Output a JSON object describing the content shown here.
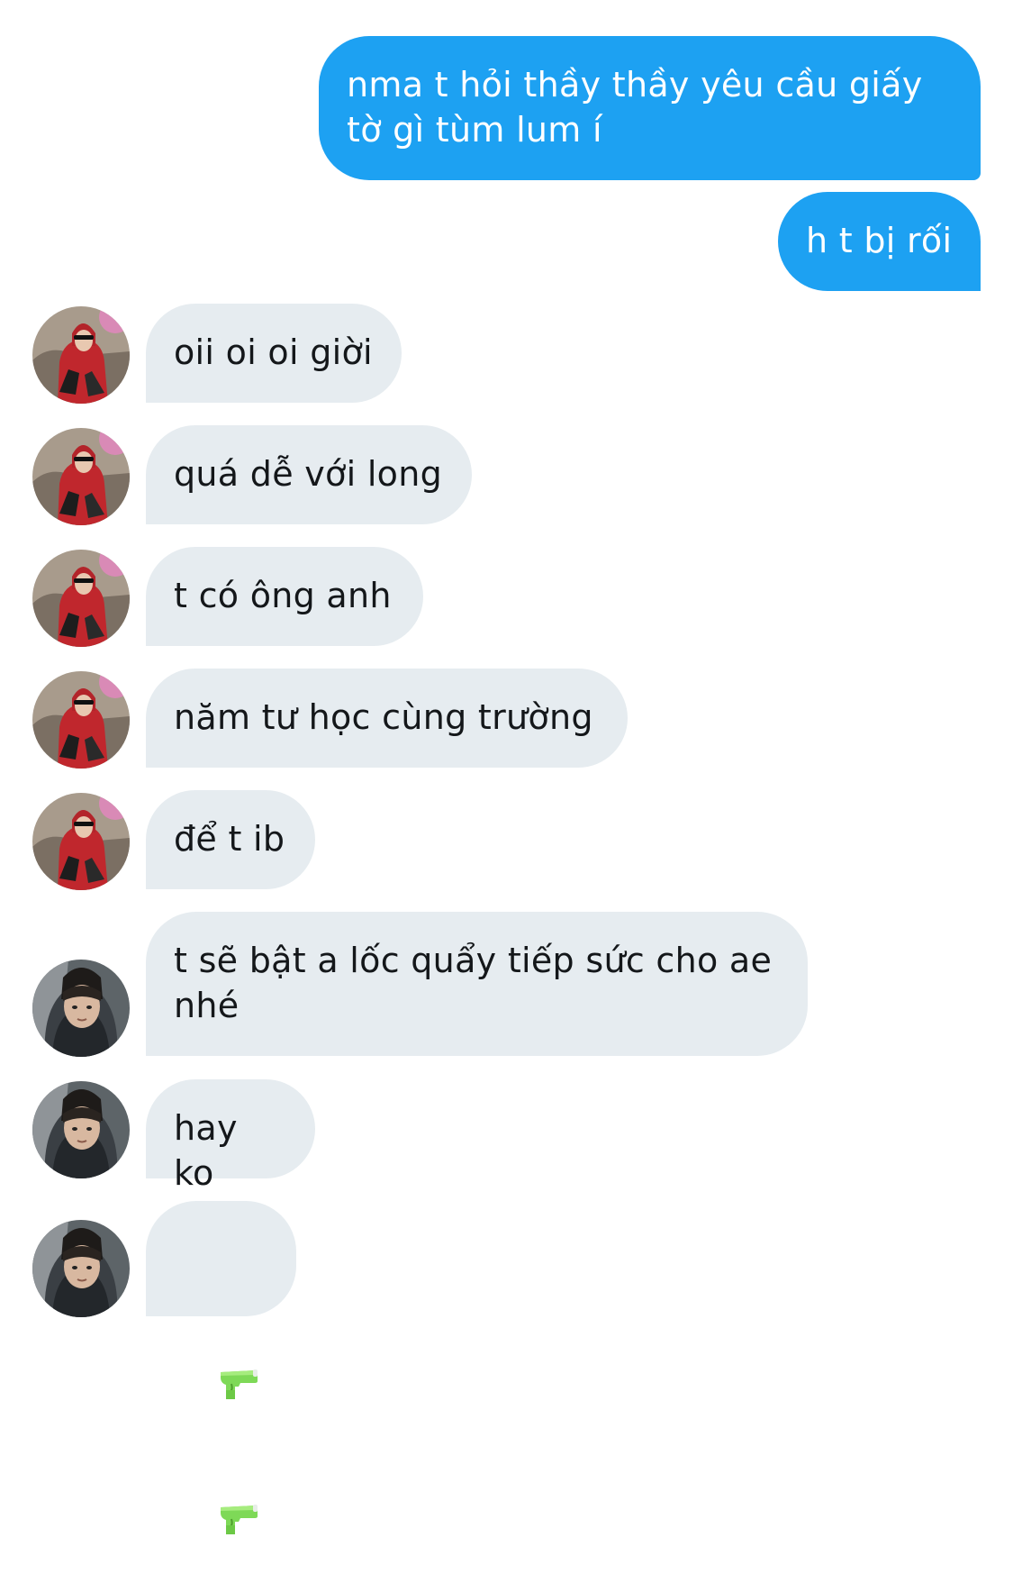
{
  "conversation": {
    "sent_messages": [
      {
        "text": "nma t hỏi thầy thầy yêu cầu giấy\ntờ gì tùm lum í"
      },
      {
        "text": "h t bị rối"
      }
    ],
    "received_messages": [
      {
        "sender": "avatar-red-hoodie",
        "text": "oii oi oi giời"
      },
      {
        "sender": "avatar-red-hoodie",
        "text": "quá dễ với long"
      },
      {
        "sender": "avatar-red-hoodie",
        "text": "t có ông anh"
      },
      {
        "sender": "avatar-red-hoodie",
        "text": "năm tư học cùng trường"
      },
      {
        "sender": "avatar-red-hoodie",
        "text": "để t ib"
      },
      {
        "sender": "avatar-dark-hoodie",
        "text": "t sẽ bật a lốc quẩy tiếp sức cho ae\nnhé"
      },
      {
        "sender": "avatar-dark-hoodie",
        "text": "hay ko"
      },
      {
        "sender": "avatar-dark-hoodie",
        "emoji": [
          "water-pistol-icon",
          "water-pistol-icon"
        ]
      }
    ]
  },
  "colors": {
    "sent_bubble": "#1da1f2",
    "received_bubble": "#e6ecf0",
    "received_text": "#14171a",
    "sent_text": "#ffffff"
  }
}
